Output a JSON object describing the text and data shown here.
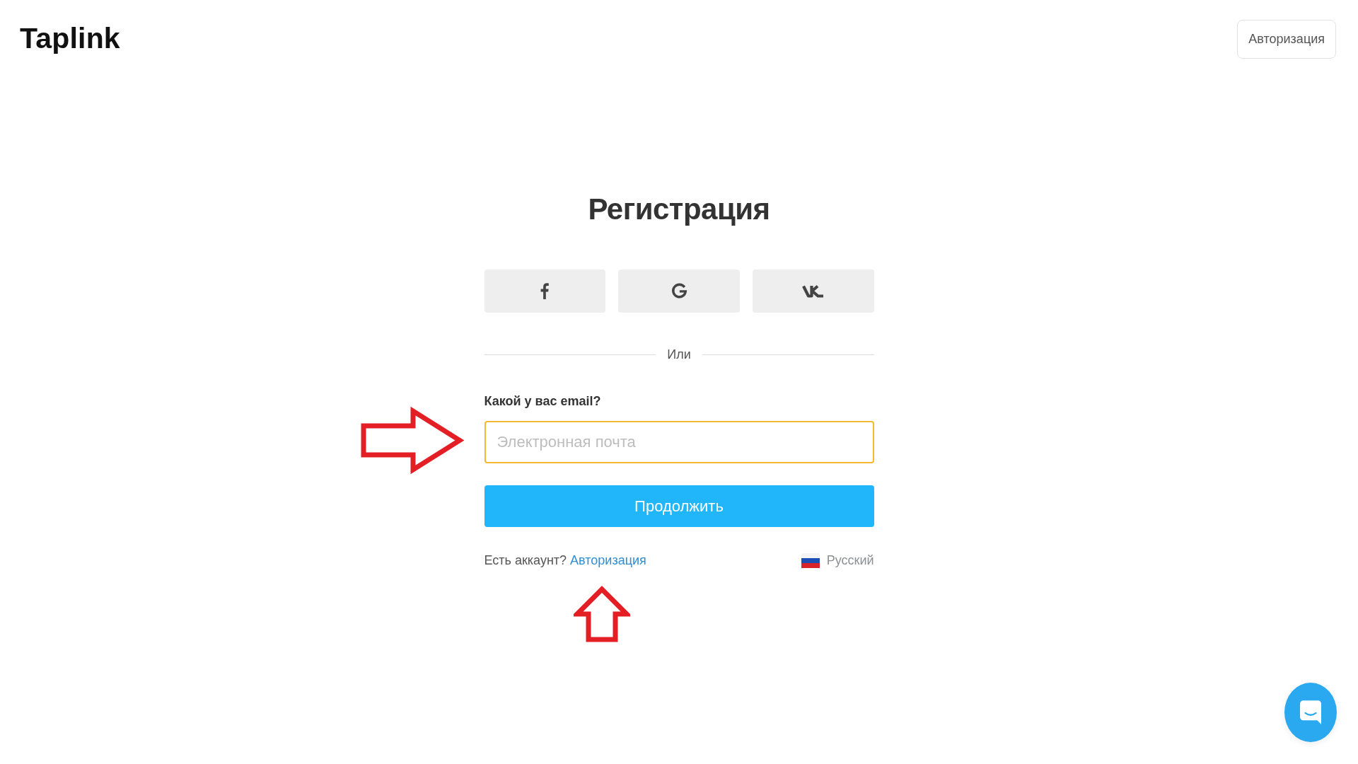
{
  "header": {
    "logo": "Taplink",
    "login_button": "Авторизация"
  },
  "form": {
    "title": "Регистрация",
    "social_buttons": [
      {
        "kind": "facebook"
      },
      {
        "kind": "google"
      },
      {
        "kind": "vk"
      }
    ],
    "divider_label": "Или",
    "email": {
      "label": "Какой у вас email?",
      "placeholder": "Электронная почта",
      "focused": true,
      "arrow_marker": true
    },
    "submit_button": "Продолжить",
    "account_prompt": {
      "text": "Есть аккаунт?",
      "link": "Авторизация",
      "arrow_marker": true
    },
    "language": {
      "label": "Русский"
    }
  }
}
